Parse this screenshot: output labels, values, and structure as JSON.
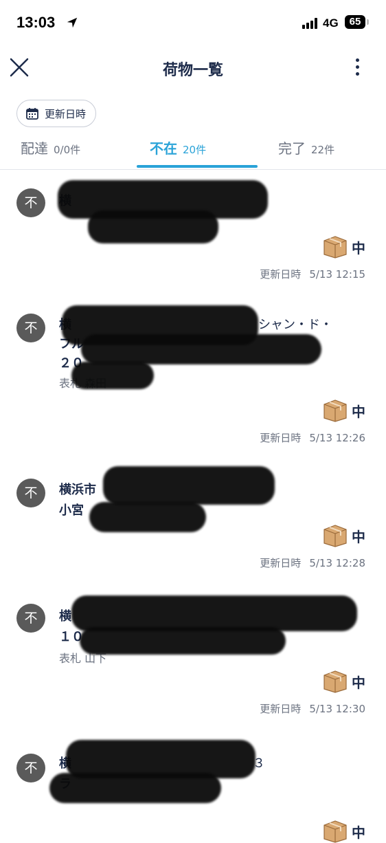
{
  "status_bar": {
    "time": "13:03",
    "network": "4G",
    "battery": "65"
  },
  "header": {
    "title": "荷物一覧"
  },
  "sort": {
    "label": "更新日時"
  },
  "tabs": [
    {
      "name": "配達",
      "count": "0/0件"
    },
    {
      "name": "不在",
      "count": "20件"
    },
    {
      "name": "完了",
      "count": "22件"
    }
  ],
  "active_tab": "不在",
  "items": [
    {
      "status": "不",
      "line1": "横",
      "line2": "",
      "line3": "",
      "size": "中",
      "updated_label": "更新日時",
      "updated": "5/13 12:15"
    },
    {
      "status": "不",
      "line1": "横",
      "line1_tail": "シャン・ド・",
      "line2": "フル",
      "line3": "２０",
      "line4": "表札 森田",
      "size": "中",
      "updated_label": "更新日時",
      "updated": "5/13 12:26"
    },
    {
      "status": "不",
      "line1": "横浜市",
      "line2": "小宮",
      "size": "中",
      "updated_label": "更新日時",
      "updated": "5/13 12:28"
    },
    {
      "status": "不",
      "line1": "横",
      "line2": "１０",
      "line3": "表札 山下",
      "size": "中",
      "updated_label": "更新日時",
      "updated": "5/13 12:30"
    },
    {
      "status": "不",
      "line1": "横",
      "line1_tail": "３",
      "line2": "ラ",
      "size": "中"
    }
  ]
}
